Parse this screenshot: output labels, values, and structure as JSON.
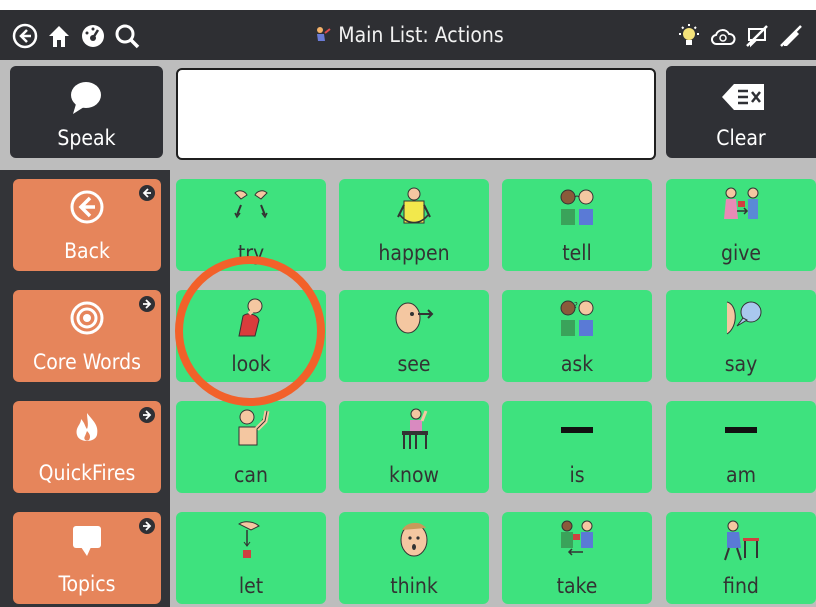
{
  "header": {
    "title": "Main List: Actions"
  },
  "message_bar": {
    "speak_label": "Speak",
    "clear_label": "Clear",
    "message_text": ""
  },
  "sidebar": {
    "items": [
      {
        "label": "Back",
        "icon": "back-arrow-icon"
      },
      {
        "label": "Core Words",
        "icon": "target-icon"
      },
      {
        "label": "QuickFires",
        "icon": "fire-icon"
      },
      {
        "label": "Topics",
        "icon": "speech-bubble-icon"
      }
    ]
  },
  "words": [
    {
      "label": "try"
    },
    {
      "label": "happen"
    },
    {
      "label": "tell"
    },
    {
      "label": "give"
    },
    {
      "label": "look"
    },
    {
      "label": "see"
    },
    {
      "label": "ask"
    },
    {
      "label": "say"
    },
    {
      "label": "can"
    },
    {
      "label": "know"
    },
    {
      "label": "is"
    },
    {
      "label": "am"
    },
    {
      "label": "let"
    },
    {
      "label": "think"
    },
    {
      "label": "take"
    },
    {
      "label": "find"
    }
  ],
  "colors": {
    "toolbar": "#2e2f33",
    "word_tile": "#3ee27e",
    "nav_tile": "#e6855b",
    "highlight": "#f2612a"
  }
}
